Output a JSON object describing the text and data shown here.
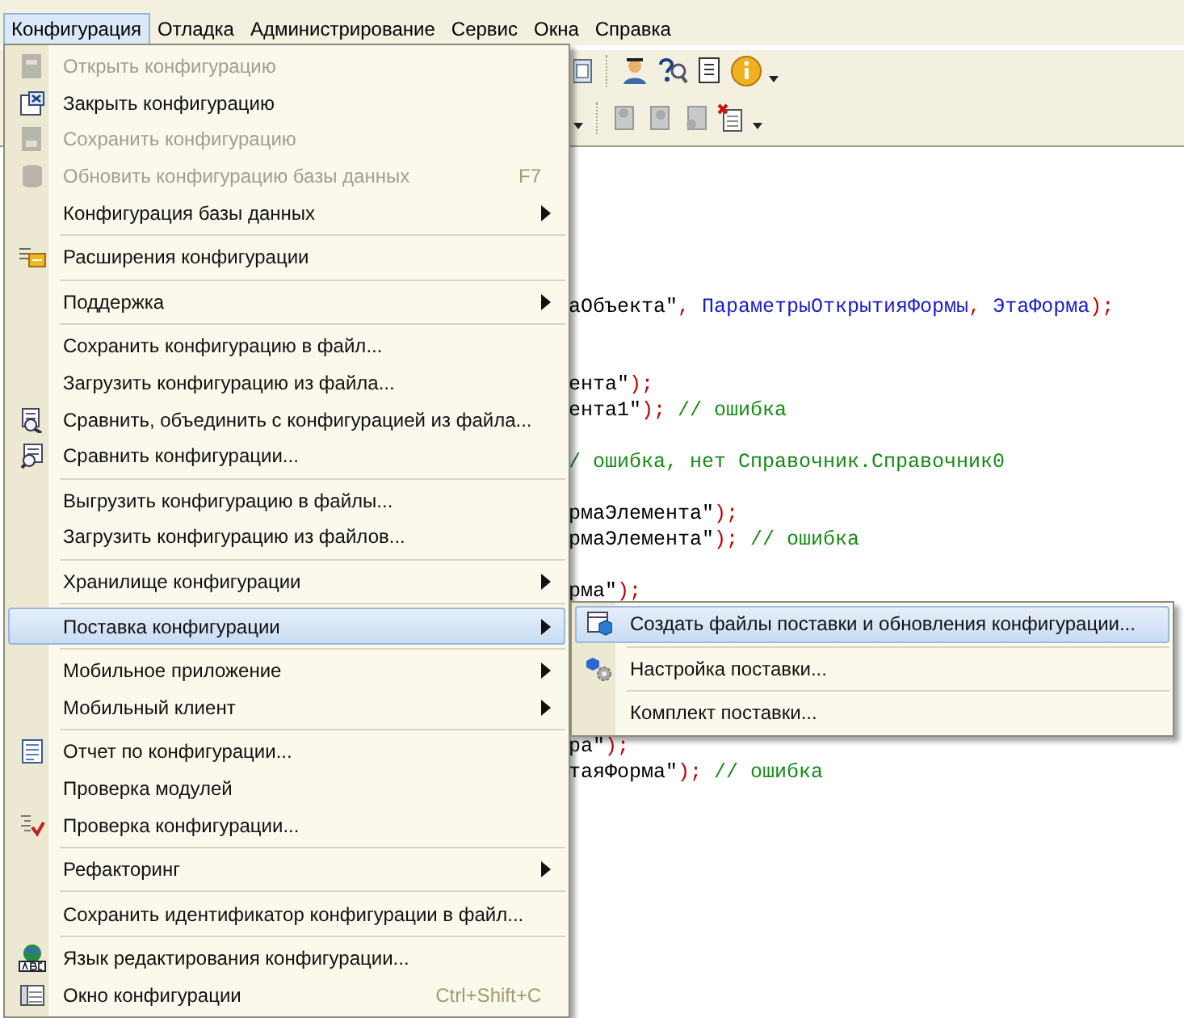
{
  "menubar": [
    {
      "label": "Конфигурация",
      "selected": true
    },
    {
      "label": "Отладка",
      "selected": false
    },
    {
      "label": "Администрирование",
      "selected": false
    },
    {
      "label": "Сервис",
      "selected": false
    },
    {
      "label": "Окна",
      "selected": false
    },
    {
      "label": "Справка",
      "selected": false
    }
  ],
  "menu": [
    {
      "kind": "item",
      "label": "Открыть конфигурацию",
      "icon": true,
      "disabled": true,
      "submenu": false,
      "selected": false
    },
    {
      "kind": "item",
      "label": "Закрыть конфигурацию",
      "icon": true,
      "disabled": false,
      "submenu": false,
      "selected": false
    },
    {
      "kind": "item",
      "label": "Сохранить конфигурацию",
      "icon": true,
      "disabled": true,
      "submenu": false,
      "selected": false
    },
    {
      "kind": "item",
      "label": "Обновить конфигурацию базы данных",
      "shortcut": "F7",
      "icon": true,
      "disabled": true,
      "submenu": false,
      "selected": false
    },
    {
      "kind": "item",
      "label": "Конфигурация базы данных",
      "icon": false,
      "disabled": false,
      "submenu": true,
      "selected": false
    },
    {
      "kind": "separator"
    },
    {
      "kind": "item",
      "label": "Расширения конфигурации",
      "icon": true,
      "disabled": false,
      "submenu": false,
      "selected": false
    },
    {
      "kind": "separator"
    },
    {
      "kind": "item",
      "label": "Поддержка",
      "icon": false,
      "disabled": false,
      "submenu": true,
      "selected": false
    },
    {
      "kind": "separator"
    },
    {
      "kind": "item",
      "label": "Сохранить конфигурацию в файл...",
      "icon": false,
      "disabled": false,
      "submenu": false,
      "selected": false
    },
    {
      "kind": "item",
      "label": "Загрузить конфигурацию из файла...",
      "icon": false,
      "disabled": false,
      "submenu": false,
      "selected": false
    },
    {
      "kind": "item",
      "label": "Сравнить, объединить с конфигурацией из файла...",
      "icon": true,
      "disabled": false,
      "submenu": false,
      "selected": false
    },
    {
      "kind": "item",
      "label": "Сравнить конфигурации...",
      "icon": true,
      "disabled": false,
      "submenu": false,
      "selected": false
    },
    {
      "kind": "separator"
    },
    {
      "kind": "item",
      "label": "Выгрузить конфигурацию в файлы...",
      "icon": false,
      "disabled": false,
      "submenu": false,
      "selected": false
    },
    {
      "kind": "item",
      "label": "Загрузить конфигурацию из файлов...",
      "icon": false,
      "disabled": false,
      "submenu": false,
      "selected": false
    },
    {
      "kind": "separator"
    },
    {
      "kind": "item",
      "label": "Хранилище конфигурации",
      "icon": false,
      "disabled": false,
      "submenu": true,
      "selected": false
    },
    {
      "kind": "separator"
    },
    {
      "kind": "item",
      "label": "Поставка конфигурации",
      "icon": false,
      "disabled": false,
      "submenu": true,
      "selected": true
    },
    {
      "kind": "separator"
    },
    {
      "kind": "item",
      "label": "Мобильное приложение",
      "icon": false,
      "disabled": false,
      "submenu": true,
      "selected": false
    },
    {
      "kind": "item",
      "label": "Мобильный клиент",
      "icon": false,
      "disabled": false,
      "submenu": true,
      "selected": false
    },
    {
      "kind": "separator"
    },
    {
      "kind": "item",
      "label": "Отчет по конфигурации...",
      "icon": true,
      "disabled": false,
      "submenu": false,
      "selected": false
    },
    {
      "kind": "item",
      "label": "Проверка модулей",
      "icon": false,
      "disabled": false,
      "submenu": false,
      "selected": false
    },
    {
      "kind": "item",
      "label": "Проверка конфигурации...",
      "icon": true,
      "disabled": false,
      "submenu": false,
      "selected": false
    },
    {
      "kind": "separator"
    },
    {
      "kind": "item",
      "label": "Рефакторинг",
      "icon": false,
      "disabled": false,
      "submenu": true,
      "selected": false
    },
    {
      "kind": "separator"
    },
    {
      "kind": "item",
      "label": "Сохранить идентификатор конфигурации в файл...",
      "icon": false,
      "disabled": false,
      "submenu": false,
      "selected": false
    },
    {
      "kind": "separator"
    },
    {
      "kind": "item",
      "label": "Язык редактирования конфигурации...",
      "icon": true,
      "disabled": false,
      "submenu": false,
      "selected": false
    },
    {
      "kind": "item",
      "label": "Окно конфигурации",
      "shortcut": "Ctrl+Shift+C",
      "icon": true,
      "disabled": false,
      "submenu": false,
      "selected": false
    }
  ],
  "submenu": [
    {
      "kind": "item",
      "label": "Создать файлы поставки и обновления конфигурации...",
      "icon": true,
      "selected": true
    },
    {
      "kind": "separator"
    },
    {
      "kind": "item",
      "label": "Настройка поставки...",
      "icon": true,
      "selected": false
    },
    {
      "kind": "separator"
    },
    {
      "kind": "item",
      "label": "Комплект поставки...",
      "icon": false,
      "selected": false
    }
  ],
  "code_lines": [
    {
      "kind": "code",
      "segments": [
        {
          "kind": "text",
          "text": "аОбъекта\""
        },
        {
          "kind": "op",
          "text": ","
        },
        {
          "kind": "ident",
          "text": " ПараметрыОткрытияФормы"
        },
        {
          "kind": "op",
          "text": ","
        },
        {
          "kind": "ident",
          "text": " ЭтаФорма"
        },
        {
          "kind": "op",
          "text": ");"
        }
      ]
    },
    {
      "kind": "blank"
    },
    {
      "kind": "blank"
    },
    {
      "kind": "code",
      "segments": [
        {
          "kind": "text",
          "text": "ента\""
        },
        {
          "kind": "op",
          "text": ");"
        }
      ]
    },
    {
      "kind": "code",
      "segments": [
        {
          "kind": "text",
          "text": "ента1\""
        },
        {
          "kind": "op",
          "text": ");"
        },
        {
          "kind": "comment",
          "text": " // ошибка"
        }
      ]
    },
    {
      "kind": "blank"
    },
    {
      "kind": "code",
      "segments": [
        {
          "kind": "comment",
          "text": "/ ошибка, нет Справочник.Справочник0"
        }
      ]
    },
    {
      "kind": "blank"
    },
    {
      "kind": "code",
      "segments": [
        {
          "kind": "text",
          "text": "рмаЭлемента\""
        },
        {
          "kind": "op",
          "text": ");"
        }
      ]
    },
    {
      "kind": "code",
      "segments": [
        {
          "kind": "text",
          "text": "рмаЭлемента\""
        },
        {
          "kind": "op",
          "text": ");"
        },
        {
          "kind": "comment",
          "text": " // ошибка"
        }
      ]
    },
    {
      "kind": "blank"
    },
    {
      "kind": "code",
      "segments": [
        {
          "kind": "text",
          "text": "рма\""
        },
        {
          "kind": "op",
          "text": ");"
        }
      ]
    },
    {
      "kind": "blank"
    },
    {
      "kind": "blank"
    },
    {
      "kind": "blank"
    },
    {
      "kind": "blank"
    },
    {
      "kind": "blank"
    },
    {
      "kind": "code",
      "segments": [
        {
          "kind": "text",
          "text": "ра\""
        },
        {
          "kind": "op",
          "text": ");"
        }
      ]
    },
    {
      "kind": "code",
      "segments": [
        {
          "kind": "text",
          "text": "таяФорма\""
        },
        {
          "kind": "op",
          "text": ");"
        },
        {
          "kind": "comment",
          "text": " // ошибка"
        }
      ]
    }
  ]
}
